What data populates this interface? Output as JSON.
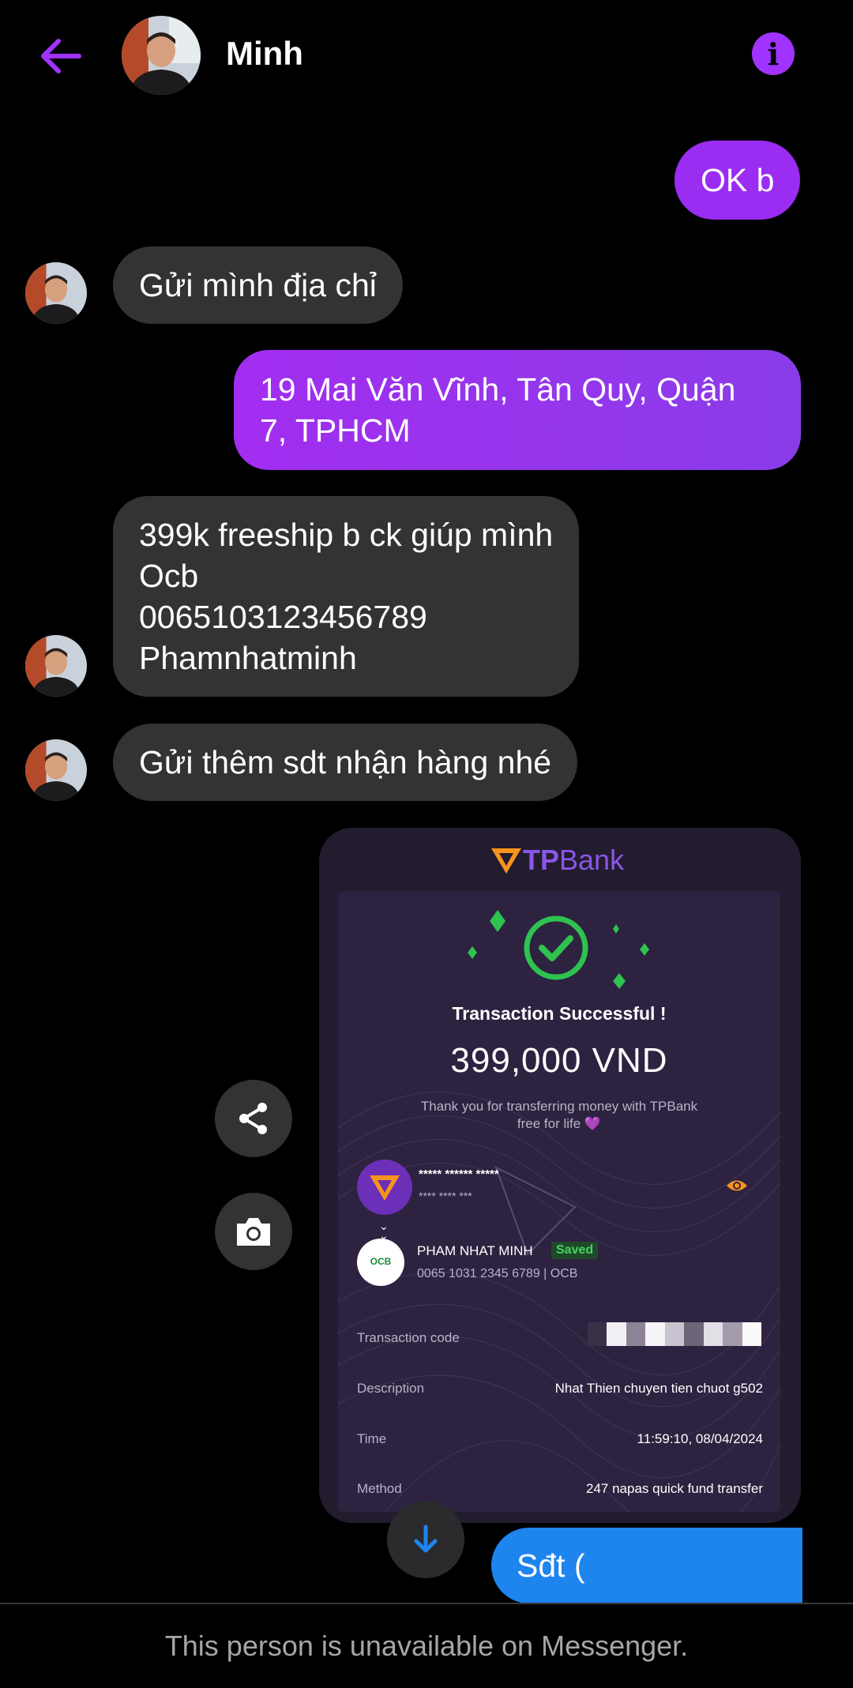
{
  "header": {
    "contact_name": "Minh",
    "info_glyph": "i"
  },
  "messages": [
    {
      "sender": "me",
      "text": "OK b"
    },
    {
      "sender": "them",
      "text": "Gửi mình địa chỉ"
    },
    {
      "sender": "me",
      "lines": [
        "19 Mai Văn Vĩnh, Tân Quy, Quận",
        "7, TPHCM"
      ]
    },
    {
      "sender": "them",
      "lines": [
        "399k freeship b ck giúp mình",
        "Ocb",
        "0065103123456789",
        "Phamnhatminh"
      ]
    },
    {
      "sender": "them",
      "text": "Gửi thêm sdt nhận hàng nhé"
    },
    {
      "sender": "me",
      "text": "Sđt ("
    }
  ],
  "receipt": {
    "bank_name_bold": "TP",
    "bank_name_thin": "Bank",
    "status": "Transaction Successful !",
    "amount": "399,000 VND",
    "thanks_line1": "Thank you for transferring money with TPBank",
    "thanks_line2": "free for life 💜",
    "sender_masked_name": "***** ****** *****",
    "sender_masked_acct": "**** **** ***",
    "receiver_name": "PHAM NHAT MINH",
    "saved_label": "Saved",
    "receiver_account": "0065 1031 2345 6789  |  OCB",
    "receiver_bank_logo": "OCB",
    "rows": [
      {
        "label": "Transaction code",
        "value": ""
      },
      {
        "label": "Description",
        "value": "Nhat Thien chuyen tien chuot g502"
      },
      {
        "label": "Time",
        "value": "11:59:10,  08/04/2024"
      },
      {
        "label": "Method",
        "value": "247 napas quick fund transfer"
      }
    ]
  },
  "footer": {
    "unavailable_text": "This person is unavailable on Messenger."
  },
  "colors": {
    "accent_purple": "#9b2cf2",
    "incoming_grey": "#333335",
    "outgoing_blue": "#1e84ee",
    "success_green": "#2ec24f"
  },
  "icons": {
    "back": "arrow-left-icon",
    "info": "info-icon",
    "share": "share-icon",
    "camera": "camera-icon",
    "scroll_down": "arrow-down-icon"
  }
}
